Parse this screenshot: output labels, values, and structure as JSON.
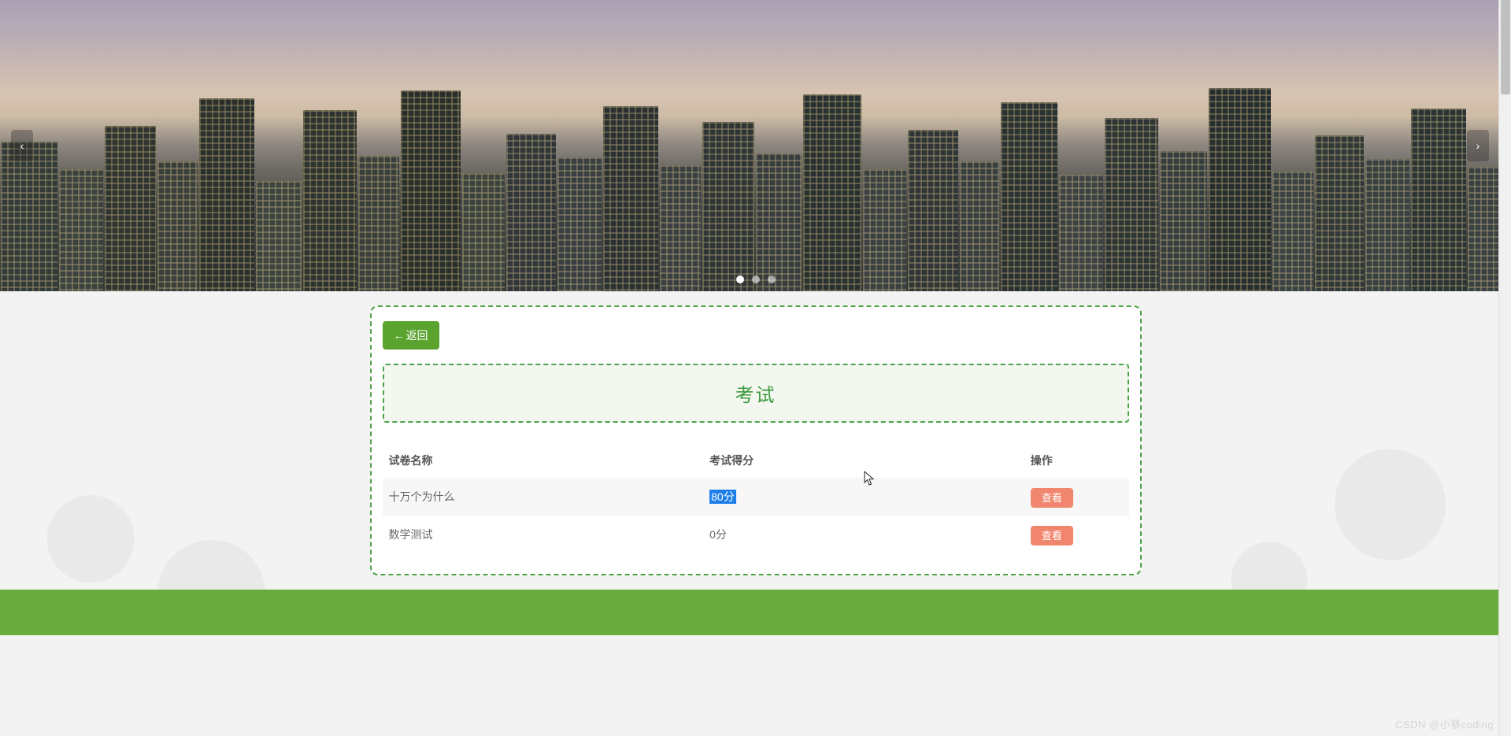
{
  "carousel": {
    "dot_count": 3,
    "active_dot": 0
  },
  "back_button": {
    "arrow": "←",
    "label": "返回"
  },
  "title": "考试",
  "columns": {
    "name": "试卷名称",
    "score": "考试得分",
    "op": "操作"
  },
  "rows": [
    {
      "name": "十万个为什么",
      "score": "80分",
      "highlighted": true,
      "op_label": "查看"
    },
    {
      "name": "数学测试",
      "score": "0分",
      "highlighted": false,
      "op_label": "查看"
    }
  ],
  "watermark": "CSDN @小蔡coding",
  "colors": {
    "accent_green": "#4aa54a",
    "button_green": "#5aa32f",
    "footer_green": "#6aad3e",
    "view_button": "#f1866e",
    "highlight_blue": "#1b7eea"
  }
}
